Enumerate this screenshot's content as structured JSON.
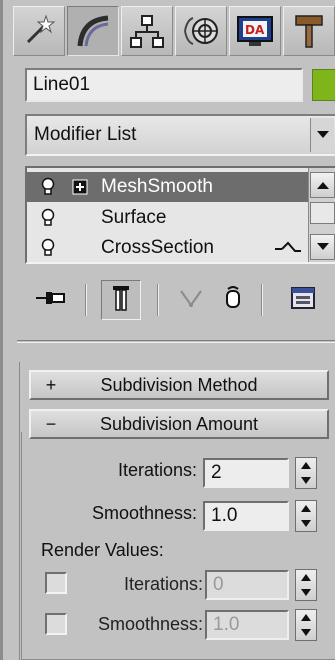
{
  "tabs": [
    {
      "icon": "create-wand-icon"
    },
    {
      "icon": "modify-arc-icon"
    },
    {
      "icon": "hierarchy-icon"
    },
    {
      "icon": "motion-icon"
    },
    {
      "icon": "display-icon"
    },
    {
      "icon": "utilities-hammer-icon"
    }
  ],
  "object": {
    "name": "Line01",
    "color": "#7db51a"
  },
  "modifier_list": {
    "label": "Modifier List"
  },
  "stack": {
    "items": [
      {
        "label": "MeshSmooth",
        "selected": true,
        "expand": "+"
      },
      {
        "label": "Surface",
        "selected": false
      },
      {
        "label": "CrossSection",
        "selected": false
      }
    ]
  },
  "rollouts": {
    "subdivision_method": {
      "sign": "+",
      "title": "Subdivision Method"
    },
    "subdivision_amount": {
      "sign": "−",
      "title": "Subdivision Amount"
    }
  },
  "params": {
    "iterations_label": "Iterations:",
    "iterations_value": "2",
    "smoothness_label": "Smoothness:",
    "smoothness_value": "1.0",
    "render_values_label": "Render Values:",
    "render_iterations_label": "Iterations:",
    "render_iterations_value": "0",
    "render_smoothness_label": "Smoothness:",
    "render_smoothness_value": "1.0"
  }
}
